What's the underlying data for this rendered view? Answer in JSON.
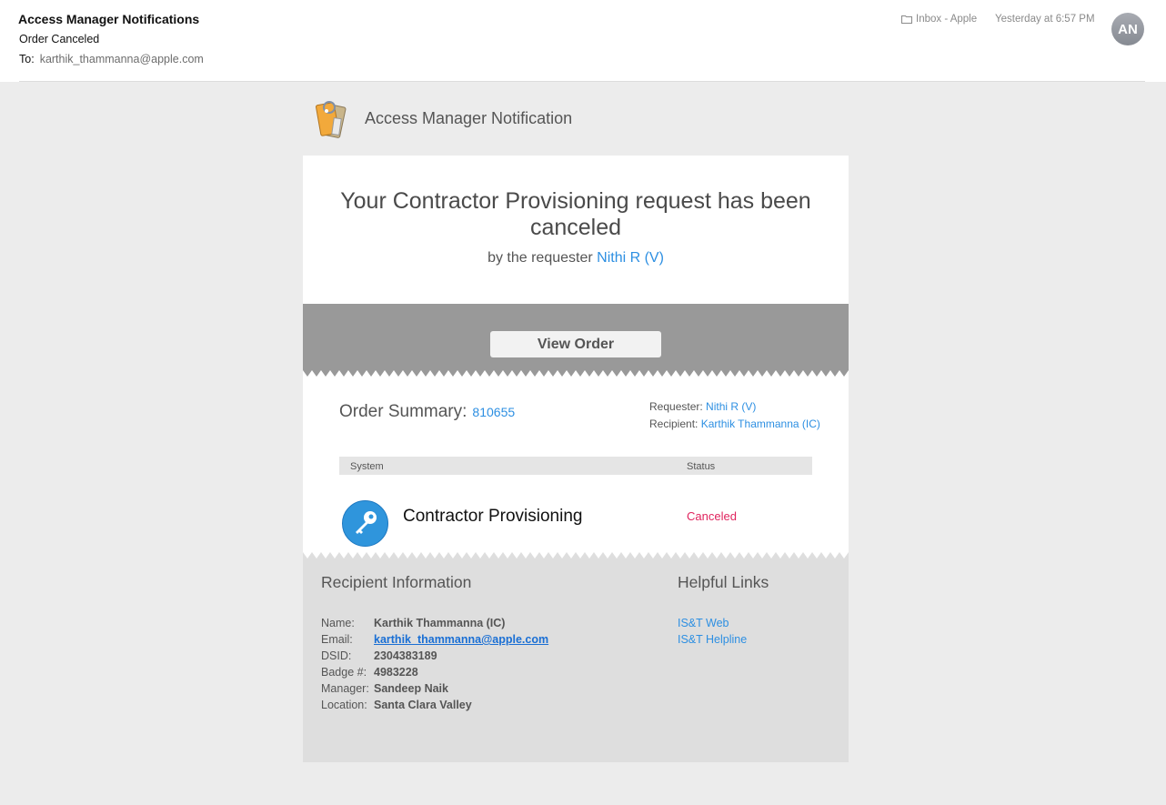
{
  "header": {
    "sender": "Access Manager Notifications",
    "subject": "Order Canceled",
    "to_label": "To:",
    "to_address": "karthik_thammanna@apple.com",
    "mailbox": "Inbox - Apple",
    "date": "Yesterday at 6:57 PM",
    "avatar_initials": "AN"
  },
  "brand": {
    "title": "Access Manager Notification",
    "icon": "tags-icon"
  },
  "notice": {
    "headline": "Your Contractor Provisioning request has been canceled",
    "by_prefix": "by the requester",
    "requester_name": "Nithi R (V)"
  },
  "actions": {
    "view_order": "View Order"
  },
  "order": {
    "title": "Order Summary:",
    "number": "810655",
    "requester_label": "Requester:",
    "requester": "Nithi R (V)",
    "recipient_label": "Recipient:",
    "recipient": "Karthik Thammanna (IC)",
    "columns": [
      "System",
      "Status"
    ],
    "items": [
      {
        "system": "Contractor Provisioning",
        "status": "Canceled",
        "icon": "key-icon"
      }
    ]
  },
  "recipient_info": {
    "title": "Recipient Information",
    "rows": [
      {
        "label": "Name:",
        "value": "Karthik Thammanna (IC)"
      },
      {
        "label": "Email:",
        "value": "karthik_thammanna@apple.com"
      },
      {
        "label": "DSID:",
        "value": "2304383189"
      },
      {
        "label": "Badge #:",
        "value": "4983228"
      },
      {
        "label": "Manager:",
        "value": "Sandeep Naik"
      },
      {
        "label": "Location:",
        "value": "Santa Clara Valley"
      }
    ]
  },
  "helpful_links": {
    "title": "Helpful Links",
    "items": [
      "IS&T Web",
      "IS&T Helpline"
    ]
  },
  "colors": {
    "link": "#2d8fe2",
    "canceled": "#e0245e",
    "band": "#999999"
  }
}
